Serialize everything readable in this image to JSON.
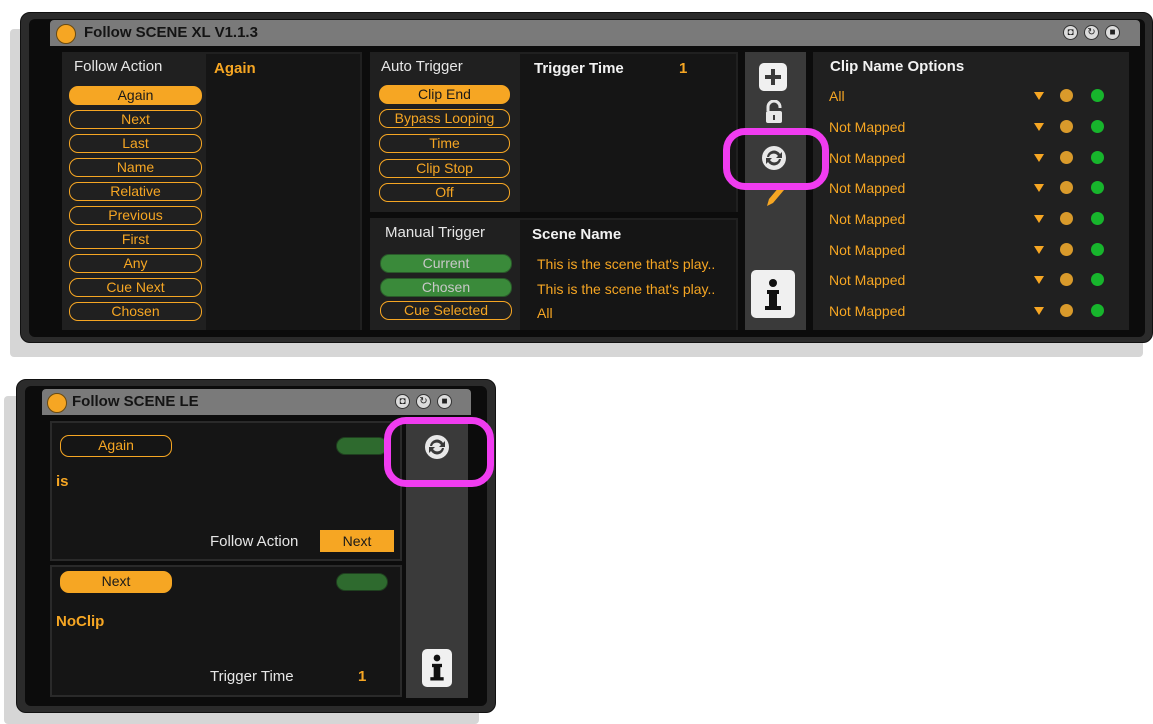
{
  "xl": {
    "title": "Follow SCENE XL V1.1.3",
    "follow_action": {
      "header": "Follow Action",
      "value": "Again",
      "options": [
        "Again",
        "Next",
        "Last",
        "Name",
        "Relative",
        "Previous",
        "First",
        "Any",
        "Cue Next",
        "Chosen"
      ],
      "selected": "Again"
    },
    "auto_trigger": {
      "header": "Auto Trigger",
      "options": [
        "Clip End",
        "Bypass Looping",
        "Time",
        "Clip Stop",
        "Off"
      ],
      "selected": "Clip End",
      "trigger_time_label": "Trigger Time",
      "trigger_time_value": "1"
    },
    "manual_trigger": {
      "header": "Manual Trigger",
      "options": [
        "Current",
        "Chosen",
        "Cue Selected"
      ],
      "scene_name_label": "Scene Name",
      "scene_names": [
        "This is the scene that's play..",
        "This is the scene that's play..",
        "All"
      ]
    },
    "clip_name_options": {
      "header": "Clip Name Options",
      "rows": [
        "All",
        "Not Mapped",
        "Not Mapped",
        "Not Mapped",
        "Not Mapped",
        "Not Mapped",
        "Not Mapped",
        "Not Mapped"
      ]
    }
  },
  "le": {
    "title": "Follow SCENE LE",
    "section1": {
      "pill": "Again",
      "text": "is",
      "label": "Follow Action",
      "value": "Next"
    },
    "section2": {
      "pill": "Next",
      "text": "NoClip",
      "label": "Trigger Time",
      "value": "1"
    }
  },
  "colors": {
    "accent": "#f6a623",
    "highlight_ring": "#f03cf0",
    "green": "#17b52c"
  },
  "icons": [
    "plus-icon",
    "lock-icon",
    "sync-icon",
    "pencil-icon",
    "info-icon",
    "header-icons"
  ]
}
